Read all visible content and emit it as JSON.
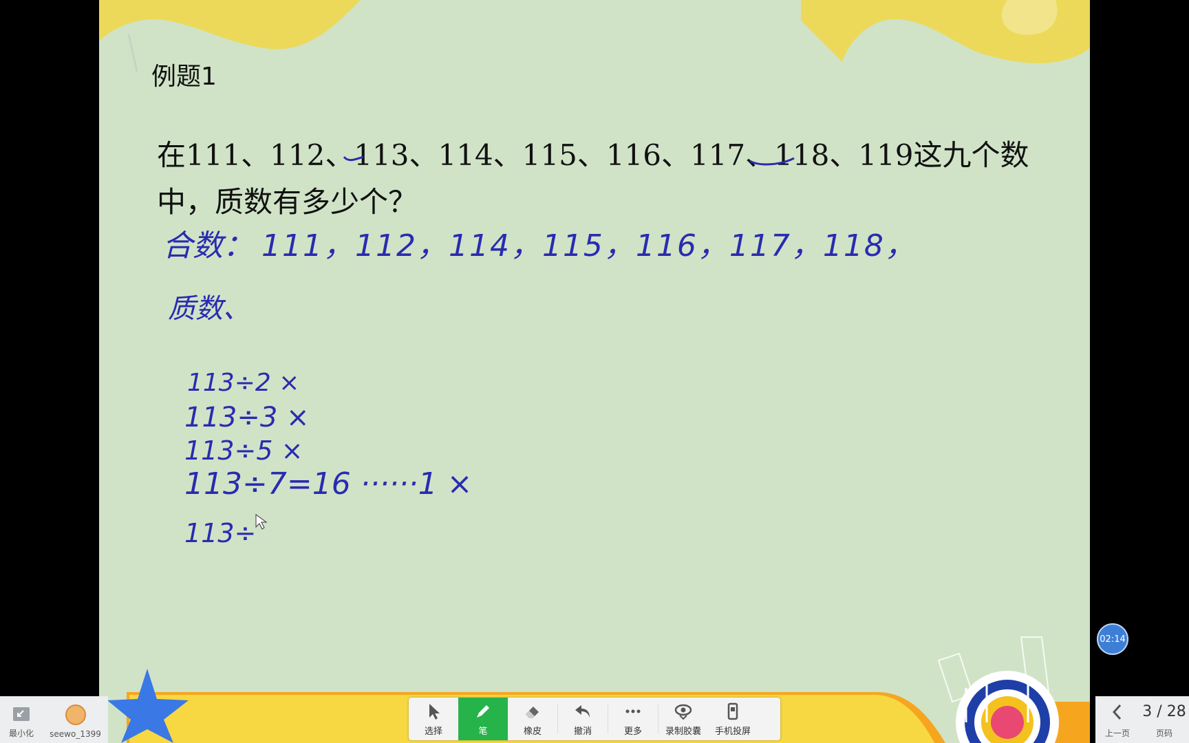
{
  "slide": {
    "title": "例题1",
    "question_line1": "在111、112、113、114、115、116、117、118、119这九个数",
    "question_line2": "中，质数有多少个？"
  },
  "handwriting": {
    "line1_label": "合数：",
    "line1_values": "111，112，114，115，116，117，118，",
    "line2_label": "质数、",
    "work1": "113÷2 ×",
    "work2": "113÷3 ×",
    "work3": "113÷5 ×",
    "work4": "113÷7=16 ······1 ×",
    "work5": "113÷"
  },
  "timer": "02:14",
  "toolbar": {
    "items": [
      {
        "label": "选择",
        "icon": "cursor-icon"
      },
      {
        "label": "笔",
        "icon": "pen-icon"
      },
      {
        "label": "橡皮",
        "icon": "eraser-icon"
      },
      {
        "label": "撤消",
        "icon": "undo-icon"
      },
      {
        "label": "更多",
        "icon": "more-icon"
      },
      {
        "label": "录制胶囊",
        "icon": "record-icon"
      },
      {
        "label": "手机投屏",
        "icon": "phone-cast-icon"
      }
    ]
  },
  "left_dock": {
    "minimize_label": "最小化",
    "user_label": "seewo_1399"
  },
  "pager": {
    "prev_label": "上一页",
    "page_text": "3 / 28",
    "page_label": "页码"
  },
  "colors": {
    "slide_bg": "#d0e3c7",
    "ink": "#2a2bb0",
    "deco_yellow": "#ecd95a",
    "active_tool": "#26b34a"
  }
}
